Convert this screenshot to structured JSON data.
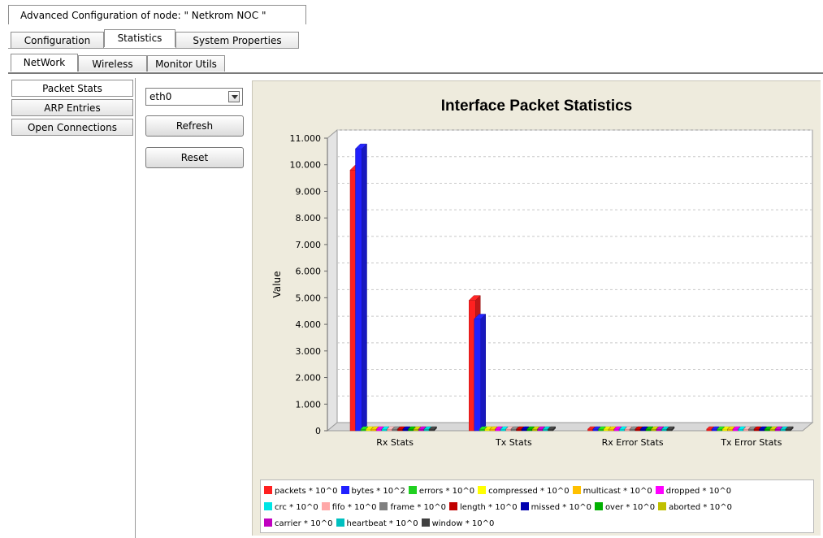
{
  "window": {
    "title": "Advanced Configuration of node:  \" Netkrom NOC \""
  },
  "tabs_main": [
    {
      "label": "Configuration",
      "active": false
    },
    {
      "label": "Statistics",
      "active": true
    },
    {
      "label": "System Properties",
      "active": false
    }
  ],
  "tabs_sub": [
    {
      "label": "NetWork",
      "active": true
    },
    {
      "label": "Wireless",
      "active": false
    },
    {
      "label": "Monitor Utils",
      "active": false
    }
  ],
  "sidebar": {
    "items": [
      {
        "label": "Packet Stats",
        "active": true
      },
      {
        "label": "ARP Entries",
        "active": false
      },
      {
        "label": "Open Connections",
        "active": false
      }
    ]
  },
  "controls": {
    "interface_select": "eth0",
    "refresh_label": "Refresh",
    "reset_label": "Reset"
  },
  "chart_data": {
    "type": "bar",
    "title": "Interface Packet Statistics",
    "ylabel": "Value",
    "xlabel": "",
    "ylim": [
      0,
      11000
    ],
    "yticks": [
      "0",
      "1.000",
      "2.000",
      "3.000",
      "4.000",
      "5.000",
      "6.000",
      "7.000",
      "8.000",
      "9.000",
      "10.000",
      "11.000"
    ],
    "categories": [
      "Rx Stats",
      "Tx Stats",
      "Rx Error Stats",
      "Tx Error Stats"
    ],
    "series": [
      {
        "name": "packets * 10^0",
        "color": "#ff2020",
        "values": [
          9800,
          4900,
          0,
          0
        ]
      },
      {
        "name": "bytes * 10^2",
        "color": "#2020ff",
        "values": [
          10600,
          4200,
          0,
          0
        ]
      },
      {
        "name": "errors * 10^0",
        "color": "#20d020",
        "values": [
          0,
          0,
          0,
          0
        ]
      },
      {
        "name": "compressed * 10^0",
        "color": "#ffff00",
        "values": [
          0,
          0,
          0,
          0
        ]
      },
      {
        "name": "multicast * 10^0",
        "color": "#ffc000",
        "values": [
          0,
          0,
          0,
          0
        ]
      },
      {
        "name": "dropped * 10^0",
        "color": "#ff00ff",
        "values": [
          0,
          0,
          0,
          0
        ]
      },
      {
        "name": "crc * 10^0",
        "color": "#00e5e5",
        "values": [
          0,
          0,
          0,
          0
        ]
      },
      {
        "name": "fifo * 10^0",
        "color": "#ffa8a8",
        "values": [
          0,
          0,
          0,
          0
        ]
      },
      {
        "name": "frame * 10^0",
        "color": "#808080",
        "values": [
          0,
          0,
          0,
          0
        ]
      },
      {
        "name": "length * 10^0",
        "color": "#c00000",
        "values": [
          0,
          0,
          0,
          0
        ]
      },
      {
        "name": "missed * 10^0",
        "color": "#0000b0",
        "values": [
          0,
          0,
          0,
          0
        ]
      },
      {
        "name": "over * 10^0",
        "color": "#00b000",
        "values": [
          0,
          0,
          0,
          0
        ]
      },
      {
        "name": "aborted * 10^0",
        "color": "#c0c000",
        "values": [
          0,
          0,
          0,
          0
        ]
      },
      {
        "name": "carrier * 10^0",
        "color": "#c000c0",
        "values": [
          0,
          0,
          0,
          0
        ]
      },
      {
        "name": "heartbeat * 10^0",
        "color": "#00c0c0",
        "values": [
          0,
          0,
          0,
          0
        ]
      },
      {
        "name": "window * 10^0",
        "color": "#404040",
        "values": [
          0,
          0,
          0,
          0
        ]
      }
    ],
    "legend_position": "bottom",
    "grid": true
  }
}
